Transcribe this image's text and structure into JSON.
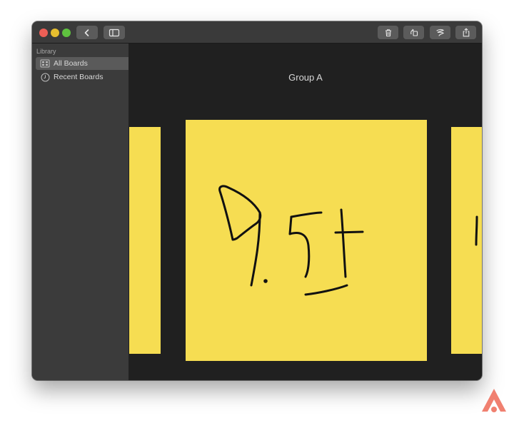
{
  "window": {
    "title_buttons": [
      "close",
      "minimize",
      "maximize"
    ],
    "toolbar": {
      "back_icon": "chevron-left-icon",
      "sidebar_toggle_icon": "sidebar-icon",
      "trash_icon": "trash-icon",
      "convert_icon": "rotate-icon",
      "pen_icon": "pen-icon",
      "share_icon": "share-icon"
    }
  },
  "sidebar": {
    "section_label": "Library",
    "items": [
      {
        "label": "All Boards",
        "icon": "grid-icon",
        "selected": true
      },
      {
        "label": "Recent Boards",
        "icon": "clock-icon",
        "selected": false
      }
    ]
  },
  "content": {
    "group_title": "Group A",
    "notes": [
      {
        "handwriting": "9.5",
        "color": "#f6dd52",
        "position": "center"
      },
      {
        "handwriting": "",
        "color": "#f6dd52",
        "position": "left-partial"
      },
      {
        "handwriting": "",
        "color": "#f6dd52",
        "position": "right-partial"
      }
    ]
  },
  "colors": {
    "note_yellow": "#f6dd52",
    "window_bg": "#202020",
    "sidebar_bg": "#3b3b3b",
    "titlebar_bg": "#3a3a3a",
    "logo_color": "#f08070"
  }
}
